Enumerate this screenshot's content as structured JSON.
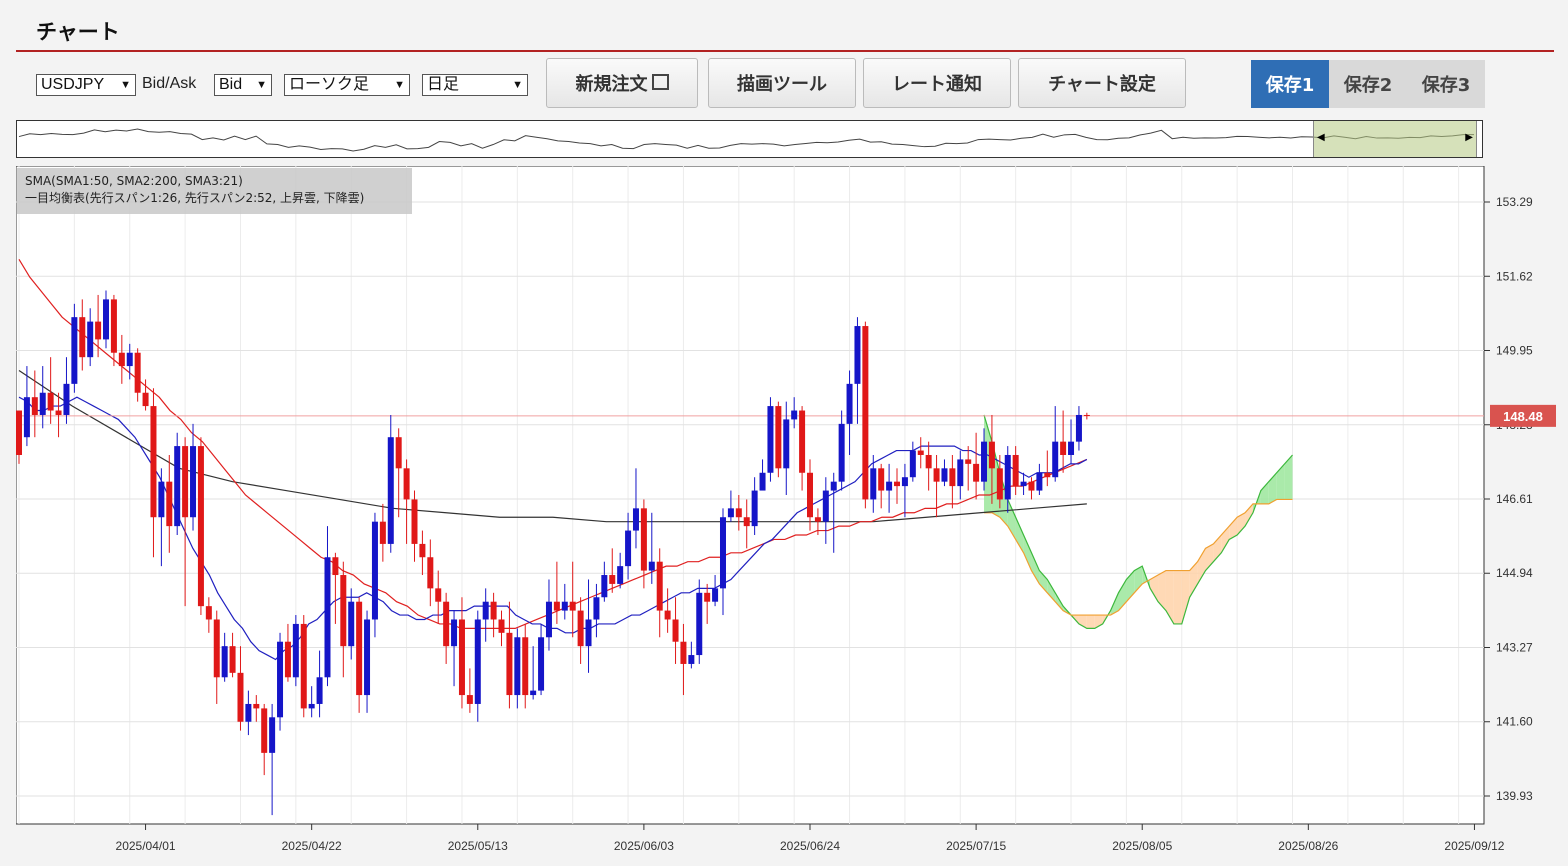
{
  "page": {
    "title": "チャート"
  },
  "toolbar": {
    "symbol": "USDJPY",
    "bidask_label": "Bid/Ask",
    "bidask_value": "Bid",
    "chart_type": "ローソク足",
    "period": "日足",
    "buttons": [
      {
        "label": "新規注文"
      },
      {
        "label": "描画ツール"
      },
      {
        "label": "レート通知"
      },
      {
        "label": "チャート設定"
      }
    ],
    "saves": [
      {
        "label": "保存1",
        "active": true
      },
      {
        "label": "保存2",
        "active": false
      },
      {
        "label": "保存3",
        "active": false
      }
    ]
  },
  "legend": {
    "line1": "SMA(SMA1:50, SMA2:200, SMA3:21)",
    "line2": "一目均衡表(先行スパン1:26, 先行スパン2:52, 上昇雲, 下降雲)"
  },
  "colors": {
    "up_candle": "#1515c8",
    "down_candle": "#e01818",
    "sma50": "#e02020",
    "sma200": "#333333",
    "sma21": "#2020c0",
    "cloud_up": "#9be69b",
    "cloud_down": "#ffd2a8",
    "span1": "#3cb83c",
    "span2": "#f0a030",
    "current_price": "#d9534f",
    "active_tab": "#2f6eb5"
  },
  "chart_data": {
    "type": "candlestick",
    "symbol": "USDJPY",
    "timeframe": "日足",
    "current_price": 148.48,
    "ylim": [
      139.3,
      154.1
    ],
    "y_ticks": [
      153.29,
      151.62,
      149.95,
      148.28,
      146.61,
      144.94,
      143.27,
      141.6,
      139.93
    ],
    "x_ticks": [
      "2025/04/01",
      "2025/04/22",
      "2025/05/13",
      "2025/06/03",
      "2025/06/24",
      "2025/07/15",
      "2025/08/05",
      "2025/08/26",
      "2025/09/12"
    ],
    "x_tick_index": [
      16,
      37,
      58,
      79,
      100,
      121,
      142,
      163,
      184
    ],
    "candles": [
      [
        148.6,
        147.6,
        148.0,
        147.4
      ],
      [
        148.0,
        148.9,
        149.6,
        147.8
      ],
      [
        148.9,
        148.5,
        149.5,
        148.0
      ],
      [
        148.5,
        149.0,
        149.6,
        148.2
      ],
      [
        149.0,
        148.6,
        149.8,
        148.3
      ],
      [
        148.6,
        148.5,
        149.0,
        148.0
      ],
      [
        148.5,
        149.2,
        149.8,
        148.3
      ],
      [
        149.2,
        150.7,
        151.0,
        149.0
      ],
      [
        150.7,
        149.8,
        151.1,
        149.5
      ],
      [
        149.8,
        150.6,
        150.9,
        149.6
      ],
      [
        150.6,
        150.2,
        151.2,
        149.8
      ],
      [
        150.2,
        151.1,
        151.3,
        150.0
      ],
      [
        151.1,
        149.9,
        151.2,
        149.6
      ],
      [
        149.9,
        149.6,
        150.3,
        149.2
      ],
      [
        149.6,
        149.9,
        150.1,
        149.3
      ],
      [
        149.9,
        149.0,
        150.0,
        148.8
      ],
      [
        149.0,
        148.7,
        149.3,
        148.6
      ],
      [
        148.7,
        146.2,
        149.1,
        145.3
      ],
      [
        146.2,
        147.0,
        147.3,
        145.1
      ],
      [
        147.0,
        146.0,
        147.6,
        145.4
      ],
      [
        146.0,
        147.8,
        148.1,
        145.8
      ],
      [
        147.8,
        146.2,
        148.0,
        144.2
      ],
      [
        146.2,
        147.8,
        148.3,
        145.9
      ],
      [
        147.8,
        144.2,
        148.0,
        144.0
      ],
      [
        144.2,
        143.9,
        144.4,
        143.6
      ],
      [
        143.9,
        142.6,
        144.1,
        142.0
      ],
      [
        142.6,
        143.3,
        143.6,
        142.5
      ],
      [
        143.3,
        142.7,
        143.6,
        142.6
      ],
      [
        142.7,
        141.6,
        143.3,
        141.4
      ],
      [
        141.6,
        142.0,
        142.3,
        141.3
      ],
      [
        142.0,
        141.9,
        142.2,
        141.6
      ],
      [
        141.9,
        140.9,
        142.0,
        140.4
      ],
      [
        140.9,
        141.7,
        142.0,
        139.5
      ],
      [
        141.7,
        143.4,
        143.6,
        141.4
      ],
      [
        143.4,
        142.6,
        143.8,
        142.5
      ],
      [
        142.6,
        143.8,
        144.0,
        142.4
      ],
      [
        143.8,
        141.9,
        144.0,
        141.7
      ],
      [
        141.9,
        142.0,
        142.4,
        141.7
      ],
      [
        142.0,
        142.6,
        143.2,
        141.7
      ],
      [
        142.6,
        145.3,
        146.0,
        142.4
      ],
      [
        145.3,
        144.9,
        145.4,
        143.8
      ],
      [
        144.9,
        143.3,
        145.2,
        142.6
      ],
      [
        143.3,
        144.3,
        144.6,
        143.0
      ],
      [
        144.3,
        142.2,
        144.4,
        141.8
      ],
      [
        142.2,
        143.9,
        144.1,
        141.8
      ],
      [
        143.9,
        146.1,
        146.3,
        143.5
      ],
      [
        146.1,
        145.6,
        146.5,
        145.2
      ],
      [
        145.6,
        148.0,
        148.5,
        145.4
      ],
      [
        148.0,
        147.3,
        148.2,
        146.2
      ],
      [
        147.3,
        146.6,
        147.5,
        145.6
      ],
      [
        146.6,
        145.6,
        146.8,
        145.2
      ],
      [
        145.6,
        145.3,
        145.9,
        144.9
      ],
      [
        145.3,
        144.6,
        145.7,
        144.2
      ],
      [
        144.6,
        144.3,
        145.0,
        143.8
      ],
      [
        144.3,
        143.3,
        144.5,
        142.9
      ],
      [
        143.3,
        143.9,
        144.1,
        142.4
      ],
      [
        143.9,
        142.2,
        144.4,
        141.9
      ],
      [
        142.2,
        142.0,
        142.8,
        141.8
      ],
      [
        142.0,
        143.9,
        144.1,
        141.6
      ],
      [
        143.9,
        144.3,
        144.6,
        143.4
      ],
      [
        144.3,
        143.9,
        144.5,
        143.5
      ],
      [
        143.9,
        143.6,
        144.1,
        143.3
      ],
      [
        143.6,
        142.2,
        144.3,
        141.9
      ],
      [
        142.2,
        143.5,
        143.7,
        141.9
      ],
      [
        143.5,
        142.2,
        143.8,
        141.9
      ],
      [
        142.2,
        142.3,
        143.3,
        142.1
      ],
      [
        142.3,
        143.5,
        143.8,
        142.2
      ],
      [
        143.5,
        144.3,
        144.8,
        143.2
      ],
      [
        144.3,
        144.1,
        145.2,
        143.8
      ],
      [
        144.1,
        144.3,
        144.7,
        143.9
      ],
      [
        144.3,
        144.1,
        145.2,
        143.5
      ],
      [
        144.1,
        143.3,
        144.4,
        142.9
      ],
      [
        143.3,
        143.9,
        144.8,
        142.7
      ],
      [
        143.9,
        144.4,
        144.7,
        143.5
      ],
      [
        144.4,
        144.9,
        145.2,
        144.3
      ],
      [
        144.9,
        144.7,
        145.5,
        144.5
      ],
      [
        144.7,
        145.1,
        145.4,
        144.6
      ],
      [
        145.1,
        145.9,
        146.3,
        144.8
      ],
      [
        145.9,
        146.4,
        147.3,
        145.5
      ],
      [
        146.4,
        145.0,
        146.6,
        144.6
      ],
      [
        145.0,
        145.2,
        146.3,
        144.7
      ],
      [
        145.2,
        144.1,
        145.5,
        143.5
      ],
      [
        144.1,
        143.9,
        144.6,
        143.6
      ],
      [
        143.9,
        143.4,
        144.4,
        142.9
      ],
      [
        143.4,
        142.9,
        143.8,
        142.2
      ],
      [
        142.9,
        143.1,
        143.4,
        142.8
      ],
      [
        143.1,
        144.5,
        144.8,
        142.9
      ],
      [
        144.5,
        144.3,
        144.7,
        143.8
      ],
      [
        144.3,
        144.6,
        144.9,
        144.2
      ],
      [
        144.6,
        146.2,
        146.4,
        144.0
      ],
      [
        146.2,
        146.4,
        146.8,
        146.1
      ],
      [
        146.4,
        146.2,
        146.7,
        145.9
      ],
      [
        146.2,
        146.0,
        146.6,
        145.5
      ],
      [
        146.0,
        146.8,
        147.1,
        145.8
      ],
      [
        146.8,
        147.2,
        147.5,
        146.9
      ],
      [
        147.2,
        148.7,
        148.9,
        147.0
      ],
      [
        148.7,
        147.3,
        148.8,
        147.1
      ],
      [
        147.3,
        148.4,
        148.8,
        146.7
      ],
      [
        148.4,
        148.6,
        148.9,
        148.2
      ],
      [
        148.6,
        147.2,
        148.7,
        146.8
      ],
      [
        147.2,
        146.2,
        147.5,
        145.9
      ],
      [
        146.2,
        146.1,
        146.4,
        145.8
      ],
      [
        146.1,
        146.8,
        147.1,
        145.6
      ],
      [
        146.8,
        147.0,
        147.2,
        145.4
      ],
      [
        147.0,
        148.3,
        148.6,
        146.8
      ],
      [
        148.3,
        149.2,
        149.5,
        147.6
      ],
      [
        149.2,
        150.5,
        150.7,
        148.3
      ],
      [
        150.5,
        146.6,
        150.6,
        146.4
      ],
      [
        146.6,
        147.3,
        147.6,
        146.3
      ],
      [
        147.3,
        146.8,
        147.4,
        146.4
      ],
      [
        146.8,
        147.0,
        147.4,
        146.3
      ],
      [
        147.0,
        146.9,
        147.3,
        146.5
      ],
      [
        146.9,
        147.1,
        147.4,
        146.2
      ],
      [
        147.1,
        147.7,
        147.9,
        147.0
      ],
      [
        147.7,
        147.6,
        148.0,
        147.3
      ],
      [
        147.6,
        147.3,
        147.9,
        146.8
      ],
      [
        147.3,
        147.0,
        147.6,
        146.2
      ],
      [
        147.0,
        147.3,
        147.5,
        146.9
      ],
      [
        147.3,
        146.9,
        147.6,
        146.4
      ],
      [
        146.9,
        147.5,
        147.7,
        146.6
      ],
      [
        147.5,
        147.4,
        147.8,
        146.8
      ],
      [
        147.4,
        147.0,
        148.1,
        146.6
      ],
      [
        147.0,
        147.9,
        148.2,
        146.8
      ],
      [
        147.9,
        147.3,
        148.5,
        146.5
      ],
      [
        147.3,
        146.6,
        147.6,
        146.4
      ],
      [
        146.6,
        147.6,
        147.8,
        146.3
      ],
      [
        147.6,
        146.9,
        147.8,
        146.7
      ],
      [
        146.9,
        147.0,
        147.2,
        146.7
      ],
      [
        147.0,
        146.8,
        147.1,
        146.6
      ],
      [
        146.8,
        147.2,
        147.4,
        146.7
      ],
      [
        147.2,
        147.1,
        147.7,
        146.9
      ],
      [
        147.1,
        147.9,
        148.7,
        147.0
      ],
      [
        147.9,
        147.6,
        148.6,
        147.2
      ],
      [
        147.6,
        147.9,
        148.4,
        147.4
      ],
      [
        147.9,
        148.5,
        148.7,
        147.7
      ],
      [
        148.5,
        148.48,
        148.55,
        148.4
      ]
    ],
    "sma21": [
      148.9,
      148.8,
      148.6,
      148.6,
      148.7,
      148.7,
      148.8,
      148.9,
      148.8,
      148.7,
      148.6,
      148.5,
      148.4,
      148.2,
      148.0,
      147.7,
      147.4,
      147.1,
      146.7,
      146.3,
      145.9,
      145.5,
      145.2,
      144.9,
      144.5,
      144.2,
      143.9,
      143.7,
      143.4,
      143.2,
      143.1,
      143.0,
      143.2,
      143.3,
      143.5,
      143.8,
      143.9,
      144.1,
      144.3,
      144.4,
      144.4,
      144.4,
      144.5,
      144.4,
      144.3,
      144.1,
      144.0,
      144.0,
      143.9,
      143.9,
      144.0,
      144.0,
      144.1,
      144.1,
      144.1,
      144.2,
      144.2,
      144.2,
      144.2,
      144.2,
      144.0,
      143.9,
      143.8,
      143.8,
      143.7,
      143.7,
      143.6,
      143.6,
      143.7,
      143.7,
      143.8,
      143.8,
      143.8,
      143.9,
      144.0,
      144.0,
      144.1,
      144.2,
      144.3,
      144.4,
      144.5,
      144.5,
      144.6,
      144.6,
      144.6,
      144.7,
      144.8,
      145.0,
      145.2,
      145.4,
      145.6,
      145.7,
      145.9,
      146.1,
      146.3,
      146.4,
      146.5,
      146.6,
      146.7,
      146.8,
      146.9,
      147.0,
      147.2,
      147.4,
      147.5,
      147.6,
      147.7,
      147.7,
      147.7,
      147.8,
      147.8,
      147.8,
      147.8,
      147.8,
      147.7,
      147.7,
      147.6,
      147.6,
      147.5,
      147.4,
      147.3,
      147.2,
      147.1,
      147.2,
      147.2,
      147.2,
      147.3,
      147.4,
      147.4,
      147.5
    ],
    "sma50": [
      152.0,
      151.6,
      151.3,
      151.0,
      150.7,
      150.5,
      150.3,
      150.1,
      149.9,
      149.7,
      149.5,
      149.3,
      149.1,
      148.9,
      148.6,
      148.4,
      148.1,
      147.9,
      147.6,
      147.3,
      147.0,
      146.7,
      146.5,
      146.3,
      146.1,
      145.9,
      145.7,
      145.5,
      145.3,
      145.2,
      145.0,
      144.9,
      144.7,
      144.6,
      144.5,
      144.3,
      144.2,
      144.0,
      143.9,
      143.8,
      143.8,
      143.7,
      143.7,
      143.7,
      143.7,
      143.7,
      143.7,
      143.8,
      143.9,
      144.0,
      144.1,
      144.2,
      144.3,
      144.4,
      144.5,
      144.6,
      144.7,
      144.8,
      144.9,
      145.0,
      145.1,
      145.1,
      145.2,
      145.2,
      145.3,
      145.3,
      145.4,
      145.4,
      145.5,
      145.6,
      145.7,
      145.7,
      145.8,
      145.8,
      145.9,
      145.9,
      146.0,
      146.0,
      146.1,
      146.1,
      146.2,
      146.2,
      146.3,
      146.3,
      146.4,
      146.4,
      146.5,
      146.5,
      146.6,
      146.7,
      146.7,
      146.8,
      146.9,
      146.9,
      147.0,
      147.1,
      147.2,
      147.3,
      147.4,
      147.5
    ],
    "sma50_start_index": 0,
    "sma200": [
      149.5,
      148.7,
      148.0,
      147.3,
      147.0,
      146.8,
      146.6,
      146.4,
      146.3,
      146.2,
      146.2,
      146.1,
      146.1,
      146.1,
      146.1,
      146.1,
      146.1,
      146.2,
      146.3,
      146.4,
      146.5
    ],
    "sma200_start_index": 0,
    "span1": [
      148.5,
      147.9,
      147.2,
      146.6,
      146.2,
      145.8,
      145.4,
      145.0,
      144.8,
      144.5,
      144.2,
      144.0,
      143.8,
      143.7,
      143.7,
      143.8,
      144.1,
      144.5,
      144.8,
      145.0,
      145.1,
      144.6,
      144.3,
      144.1,
      143.8,
      143.8,
      144.4,
      144.7,
      145.0,
      145.2,
      145.4,
      145.7,
      145.8,
      146.0,
      146.3,
      146.8,
      147.0,
      147.2,
      147.4,
      147.6
    ],
    "span2": [
      146.3,
      146.3,
      146.2,
      146.0,
      145.7,
      145.4,
      145.0,
      144.7,
      144.5,
      144.3,
      144.1,
      144.0,
      144.0,
      144.0,
      144.0,
      144.0,
      144.0,
      144.1,
      144.3,
      144.5,
      144.7,
      144.8,
      144.9,
      145.0,
      145.0,
      145.0,
      145.0,
      145.2,
      145.5,
      145.6,
      145.8,
      146.0,
      146.2,
      146.3,
      146.5,
      146.5,
      146.5,
      146.6,
      146.6,
      146.6
    ],
    "sma_labels": [
      "SMA1:50",
      "SMA2:200",
      "SMA3:21"
    ]
  }
}
